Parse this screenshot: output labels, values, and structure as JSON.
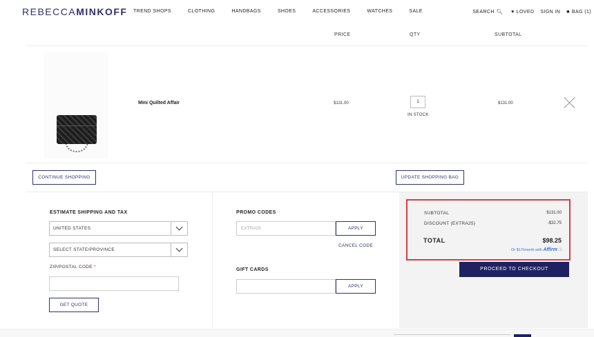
{
  "header": {
    "logo_part1": "REBECCA",
    "logo_part2": "MINKOFF",
    "nav": [
      "TREND SHOPS",
      "CLOTHING",
      "HANDBAGS",
      "SHOES",
      "ACCESSORIES",
      "WATCHES",
      "SALE"
    ],
    "search": "SEARCH",
    "loved": "LOVED",
    "sign_in": "SIGN IN",
    "bag": "BAG (1)"
  },
  "cart": {
    "columns": {
      "price": "PRICE",
      "qty": "QTY",
      "subtotal": "SUBTOTAL"
    },
    "items": [
      {
        "name": "Mini Quilted Affair",
        "price": "$131.00",
        "qty": "1",
        "stock": "IN STOCK",
        "subtotal": "$131.00"
      }
    ]
  },
  "actions": {
    "continue_shopping": "CONTINUE SHOPPING",
    "update_bag": "UPDATE SHOPPING BAG"
  },
  "shipping": {
    "title": "ESTIMATE SHIPPING AND TAX",
    "country": "UNITED STATES",
    "state": "SELECT STATE/PROVINCE",
    "zip_label": "ZIP/POSTAL CODE",
    "zip_required": "*",
    "get_quote": "GET QUOTE"
  },
  "promo": {
    "title": "PROMO CODES",
    "code_value": "EXTRA25",
    "apply": "APPLY",
    "cancel": "CANCEL CODE"
  },
  "gift": {
    "title": "GIFT CARDS",
    "apply": "APPLY"
  },
  "summary": {
    "subtotal_label": "SUBTOTAL",
    "subtotal_value": "$131.00",
    "discount_label": "DISCOUNT (EXTRA25)",
    "discount_value": "-$32.75",
    "total_label": "TOTAL",
    "total_value": "$98.25",
    "affirm_prefix": "Or $17/month with",
    "affirm_brand": "Affirm",
    "checkout": "PROCEED TO CHECKOUT"
  },
  "colors": {
    "brand": "#2d2f6f",
    "checkout": "#1f2260",
    "highlight": "#e0393e"
  }
}
